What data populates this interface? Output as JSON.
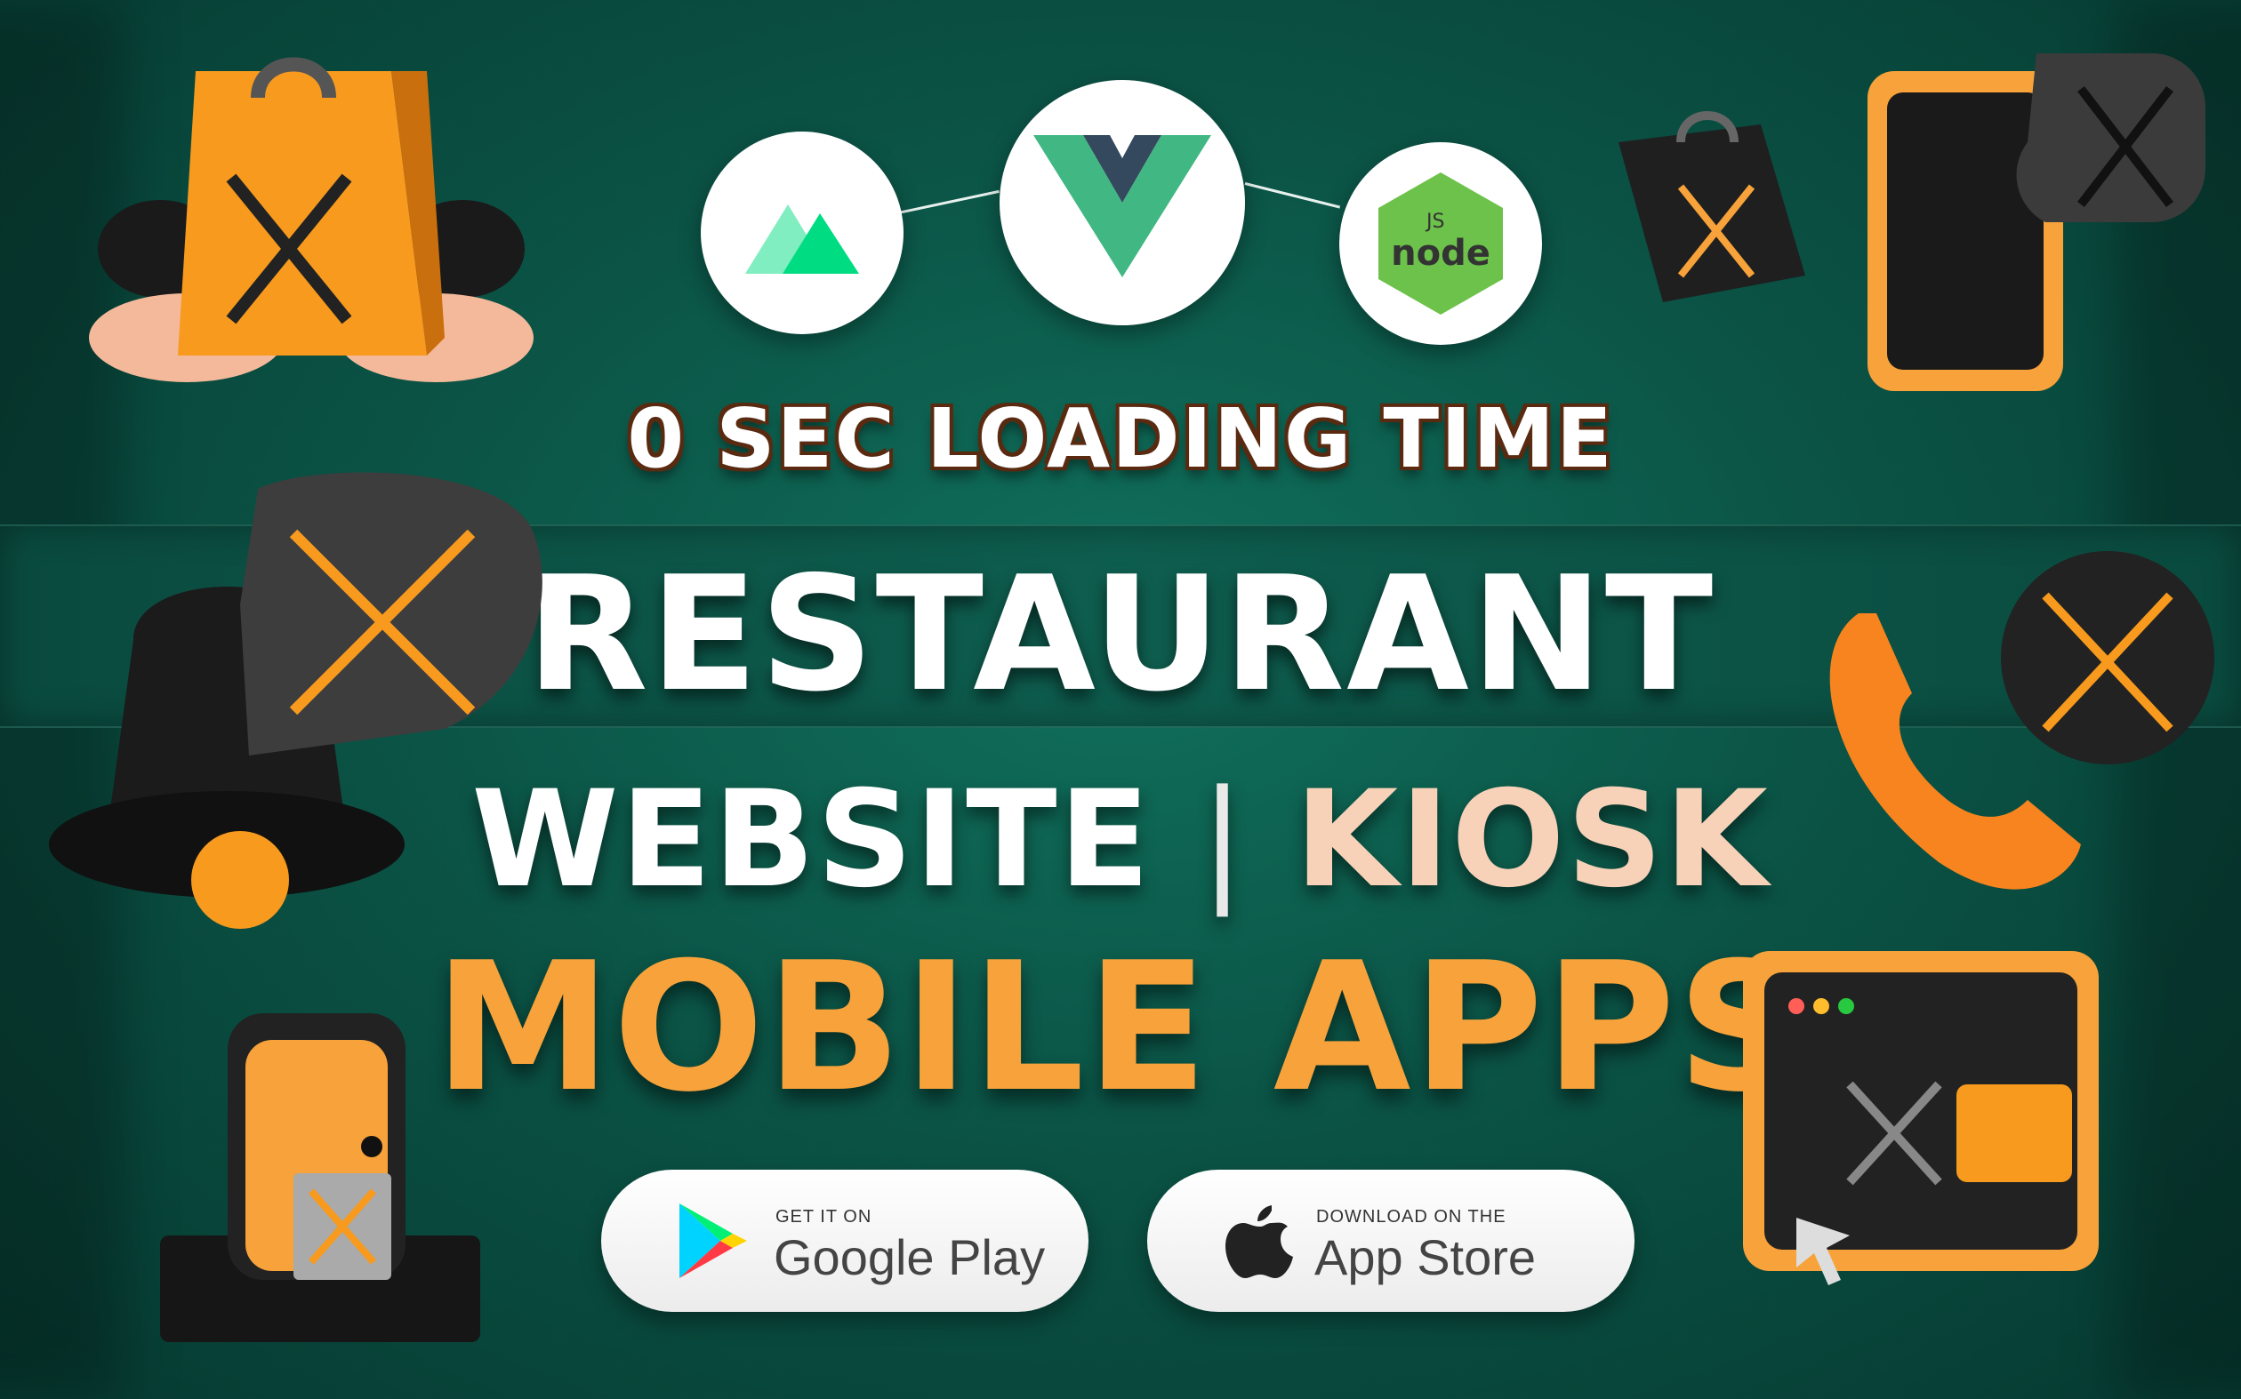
{
  "headline": {
    "loading": "0 SEC LOADING TIME",
    "restaurant": "RESTAURANT",
    "website": "WEBSITE",
    "separator": "|",
    "kiosk": "KIOSK",
    "mobile_apps": "MOBILE APPS"
  },
  "tech_logos": [
    "nuxt-logo",
    "vue-logo",
    "node-logo"
  ],
  "node_logo_text": {
    "js": "JS",
    "node": "node"
  },
  "stores": {
    "google": {
      "small": "GET IT ON",
      "big": "Google Play"
    },
    "apple": {
      "small": "DOWNLOAD ON THE",
      "big": "App Store"
    }
  },
  "colors": {
    "background": "#0b5446",
    "accent_orange": "#f7a23a",
    "kiosk_peach": "#f7d2b8"
  },
  "icons": [
    "shopping-bag-hands-icon",
    "shopping-bag-small-icon",
    "tablet-chat-icon",
    "bell-chat-icon",
    "phone-chat-icon",
    "door-bag-icon",
    "browser-card-icon"
  ]
}
